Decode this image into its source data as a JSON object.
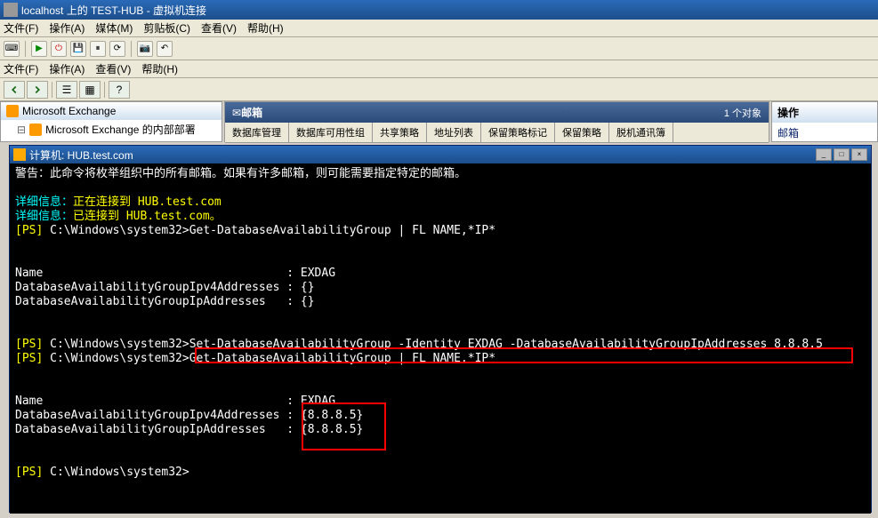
{
  "window": {
    "title": "localhost 上的 TEST-HUB - 虚拟机连接"
  },
  "menu1": {
    "file": "文件(F)",
    "action": "操作(A)",
    "media": "媒体(M)",
    "clipboard": "剪贴板(C)",
    "view": "查看(V)",
    "help": "帮助(H)"
  },
  "menu2": {
    "file": "文件(F)",
    "action": "操作(A)",
    "view": "查看(V)",
    "help": "帮助(H)"
  },
  "tree": {
    "root": "Microsoft Exchange",
    "child": "Microsoft Exchange 的内部部署"
  },
  "center": {
    "title": "邮箱",
    "count": "1 个对象",
    "tabs": [
      "数据库管理",
      "数据库可用性组",
      "共享策略",
      "地址列表",
      "保留策略标记",
      "保留策略",
      "脱机通讯簿"
    ]
  },
  "right": {
    "header": "操作",
    "sub": "邮箱"
  },
  "terminal": {
    "title": "计算机: HUB.test.com",
    "warning": "警告：此命令将枚举组织中的所有邮箱。如果有许多邮箱，则可能需要指定特定的邮箱。",
    "detail1_label": "详细信息：",
    "detail1_text": "正在连接到 HUB.test.com",
    "detail2_label": "详细信息：",
    "detail2_text": "已连接到 HUB.test.com。",
    "ps": "[PS]",
    "path": " C:\\Windows\\system32>",
    "cmd1": "Get-DatabaseAvailabilityGroup | FL NAME,*IP*",
    "out1": {
      "name_label": "Name                                   : ",
      "name_val": "EXDAG",
      "ipv4_label": "DatabaseAvailabilityGroupIpv4Addresses : ",
      "ipv4_val": "{}",
      "ip_label": "DatabaseAvailabilityGroupIpAddresses   : ",
      "ip_val": "{}"
    },
    "cmd2": "Set-DatabaseAvailabilityGroup -Identity EXDAG -DatabaseAvailabilityGroupIpAddresses 8.8.8.5",
    "cmd3": "Get-DatabaseAvailabilityGroup | FL NAME,*IP*",
    "out2": {
      "name_label": "Name                                   : ",
      "name_val": "EXDAG",
      "ipv4_label": "DatabaseAvailabilityGroupIpv4Addresses : ",
      "ipv4_val": "{8.8.8.5}",
      "ip_label": "DatabaseAvailabilityGroupIpAddresses   : ",
      "ip_val": "{8.8.8.5}"
    }
  }
}
